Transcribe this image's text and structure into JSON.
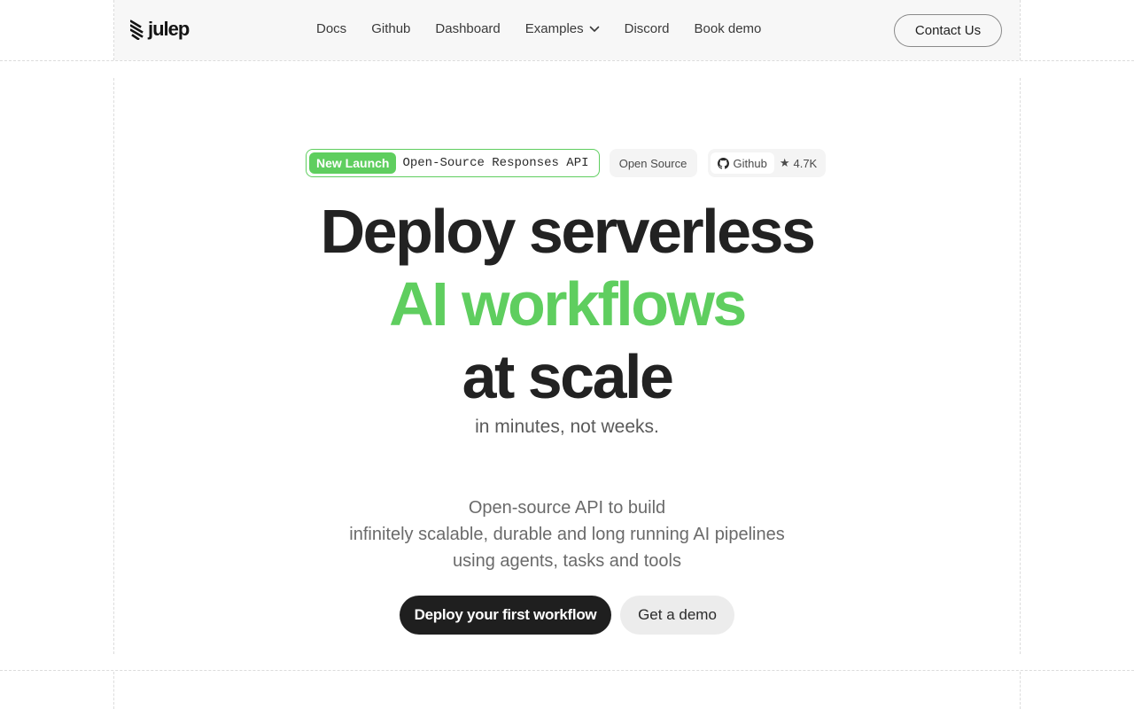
{
  "brand": {
    "name": "julep"
  },
  "nav": {
    "links": [
      {
        "label": "Docs"
      },
      {
        "label": "Github"
      },
      {
        "label": "Dashboard"
      },
      {
        "label": "Examples"
      },
      {
        "label": "Discord"
      },
      {
        "label": "Book demo"
      }
    ],
    "contact_label": "Contact Us"
  },
  "badges": {
    "launch_pill": "New Launch",
    "launch_text": "Open-Source Responses API",
    "open_source": "Open Source",
    "github_label": "Github",
    "github_stars": "4.7K",
    "star_glyph": "★"
  },
  "hero": {
    "line1": "Deploy serverless",
    "line2": "AI workflows",
    "line3": "at scale",
    "tagline": "in minutes, not weeks."
  },
  "description": {
    "line1": "Open-source API to build",
    "line2": "infinitely scalable, durable and long running AI pipelines",
    "line3": "using agents, tasks and tools"
  },
  "cta": {
    "primary": "Deploy your first workflow",
    "secondary": "Get a demo"
  },
  "colors": {
    "accent": "#5fce5f",
    "dark": "#1f1f1f",
    "navbar_bg": "#f7f7f7"
  },
  "icons": {
    "logo": "julep-logo-icon",
    "examples_chevron": "chevron-down-icon",
    "github": "github-icon"
  }
}
